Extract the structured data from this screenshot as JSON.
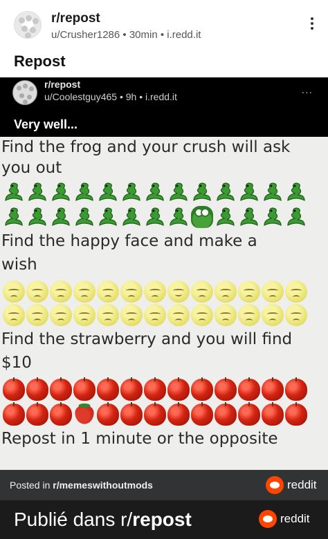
{
  "post": {
    "subreddit": "r/repost",
    "meta": "u/Crusher1286 • 30min • i.redd.it",
    "title": "Repost"
  },
  "embedded": {
    "subreddit": "r/repost",
    "meta": "u/Coolestguy465 • 9h • i.redd.it",
    "more": "...",
    "title": "Very well...",
    "lines": [
      "Find the frog and your crush will ask",
      "you out",
      "Find the happy face and make a",
      "wish",
      "Find the strawberry and you will find",
      "$10",
      "Repost in 1 minute or the opposite"
    ],
    "icons": {
      "row_1": "snake-icon",
      "frog": "frog-icon",
      "face": "pensive-face-icon",
      "happy": "relieved-face-icon",
      "apple": "apple-icon",
      "strawberry": "strawberry-icon"
    }
  },
  "footer": {
    "posted_prefix": "Posted in ",
    "posted_sub": "r/memeswithoutmods",
    "brand": "reddit"
  },
  "bottom": {
    "prefix": "Publié dans r/",
    "sub": "repost",
    "brand": "reddit"
  },
  "colors": {
    "brand": "#ff4500",
    "inner_header": "#000000",
    "footer": "#323334",
    "bottom": "#1b1b1b"
  }
}
